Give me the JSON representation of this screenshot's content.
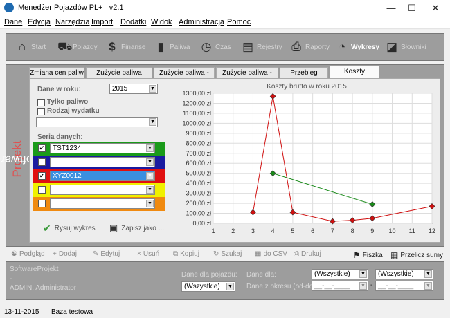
{
  "window": {
    "title": "Menedżer Pojazdów PL+",
    "version": "v2.1"
  },
  "menu": [
    "Dane",
    "Edycja",
    "Narzędzia",
    "Import",
    "Dodatki",
    "Widok",
    "Administracja",
    "Pomoc"
  ],
  "toolbar": [
    {
      "label": "Start",
      "icon": "home-icon"
    },
    {
      "label": "Pojazdy",
      "icon": "car-icon"
    },
    {
      "label": "Finanse",
      "icon": "dollar-icon"
    },
    {
      "label": "Paliwa",
      "icon": "fuel-can-icon"
    },
    {
      "label": "Czas",
      "icon": "clock-icon"
    },
    {
      "label": "Rejestry",
      "icon": "notebook-icon"
    },
    {
      "label": "Raporty",
      "icon": "printer-icon"
    },
    {
      "label": "Wykresy",
      "icon": "pie-chart-icon"
    },
    {
      "label": "Słowniki",
      "icon": "book-icon"
    }
  ],
  "brand": {
    "part1": "Software",
    "part2": "Projekt"
  },
  "tabs": [
    "Zmiana cen paliw",
    "Zużycie paliwa ciągłe",
    "Zużycie paliwa - km",
    "Zużycie paliwa - Mth",
    "Przebieg",
    "Koszty"
  ],
  "form": {
    "year_label": "Dane w roku:",
    "year_value": "2015",
    "only_fuel_label": "Tylko paliwo",
    "expense_type_label": "Rodzaj wydatku",
    "series_label": "Seria danych:",
    "series": [
      {
        "value": "TST1234",
        "checked": true,
        "color": "#1a9a1a"
      },
      {
        "value": "",
        "checked": false,
        "color": "#1a1aa0"
      },
      {
        "value": "XYZ0012",
        "checked": true,
        "color": "#e01010"
      },
      {
        "value": "",
        "checked": false,
        "color": "#f0f000"
      },
      {
        "value": "",
        "checked": false,
        "color": "#f08a10"
      }
    ],
    "draw_label": "Rysuj wykres",
    "save_label": "Zapisz jako ..."
  },
  "chart_data": {
    "type": "line",
    "title": "Koszty brutto w roku 2015",
    "xlim": [
      1,
      12
    ],
    "ylim": [
      0,
      1300
    ],
    "x_ticks": [
      1,
      2,
      3,
      4,
      5,
      6,
      7,
      8,
      9,
      10,
      11,
      12
    ],
    "y_ticks": [
      "0,00 zł",
      "100,00 zł",
      "200,00 zł",
      "300,00 zł",
      "400,00 zł",
      "500,00 zł",
      "600,00 zł",
      "700,00 zł",
      "800,00 zł",
      "900,00 zł",
      "1000,00 zł",
      "1100,00 zł",
      "1200,00 zł",
      "1300,00 zł"
    ],
    "series": [
      {
        "color": "#1a8a1a",
        "x": [
          4,
          9
        ],
        "y": [
          500,
          190
        ]
      },
      {
        "color": "#d01010",
        "x": [
          3,
          4,
          5,
          7,
          8,
          9,
          12
        ],
        "y": [
          110,
          1270,
          110,
          20,
          30,
          50,
          170
        ]
      }
    ]
  },
  "actions": [
    {
      "label": "Podgląd",
      "icon": "preview-icon",
      "on": false
    },
    {
      "label": "Dodaj",
      "icon": "add-icon",
      "on": false
    },
    {
      "label": "Edytuj",
      "icon": "edit-icon",
      "on": false
    },
    {
      "label": "Usuń",
      "icon": "delete-icon",
      "on": false
    },
    {
      "label": "Kopiuj",
      "icon": "copy-icon",
      "on": false
    },
    {
      "label": "Szukaj",
      "icon": "search-icon",
      "on": false
    },
    {
      "label": "do CSV",
      "icon": "csv-icon",
      "on": false
    },
    {
      "label": "Drukuj",
      "icon": "print-icon",
      "on": false
    },
    {
      "label": "Fiszka",
      "icon": "tag-icon",
      "on": true
    },
    {
      "label": "Przelicz sumy",
      "icon": "calculator-icon",
      "on": true
    }
  ],
  "info": {
    "company": "SoftwareProjekt",
    "dash": "-",
    "user": "ADMIN, Administrator"
  },
  "filter": {
    "vehicle_label": "Dane dla pojazdu:",
    "vehicle_value": "(Wszystkie)",
    "for_label": "Dane dla:",
    "for_value": "(Wszystkie)",
    "for_value2": "(Wszystkie)",
    "range_label": "Dane z okresu (od-do):",
    "date_from": "__-__-____",
    "date_to": "__-__-____"
  },
  "status": {
    "date": "13-11-2015",
    "db": "Baza testowa"
  }
}
